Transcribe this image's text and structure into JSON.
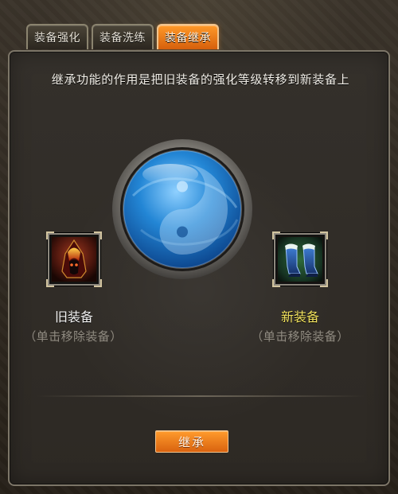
{
  "tabs": [
    {
      "label": "装备强化",
      "active": false
    },
    {
      "label": "装备洗练",
      "active": false
    },
    {
      "label": "装备继承",
      "active": true
    }
  ],
  "panel": {
    "description": "继承功能的作用是把旧装备的强化等级转移到新装备上",
    "old_slot": {
      "label": "旧装备",
      "hint": "（单击移除装备）",
      "item_icon": "flaming-hood-icon"
    },
    "new_slot": {
      "label": "新装备",
      "hint": "（单击移除装备）",
      "item_icon": "blue-boots-icon"
    },
    "center_icon": "yin-yang-orb-icon",
    "action_button": "继承"
  },
  "colors": {
    "accent_orange": "#ff9b2d",
    "new_label_yellow": "#f1e15e",
    "hint_gray": "#8f8a80"
  }
}
